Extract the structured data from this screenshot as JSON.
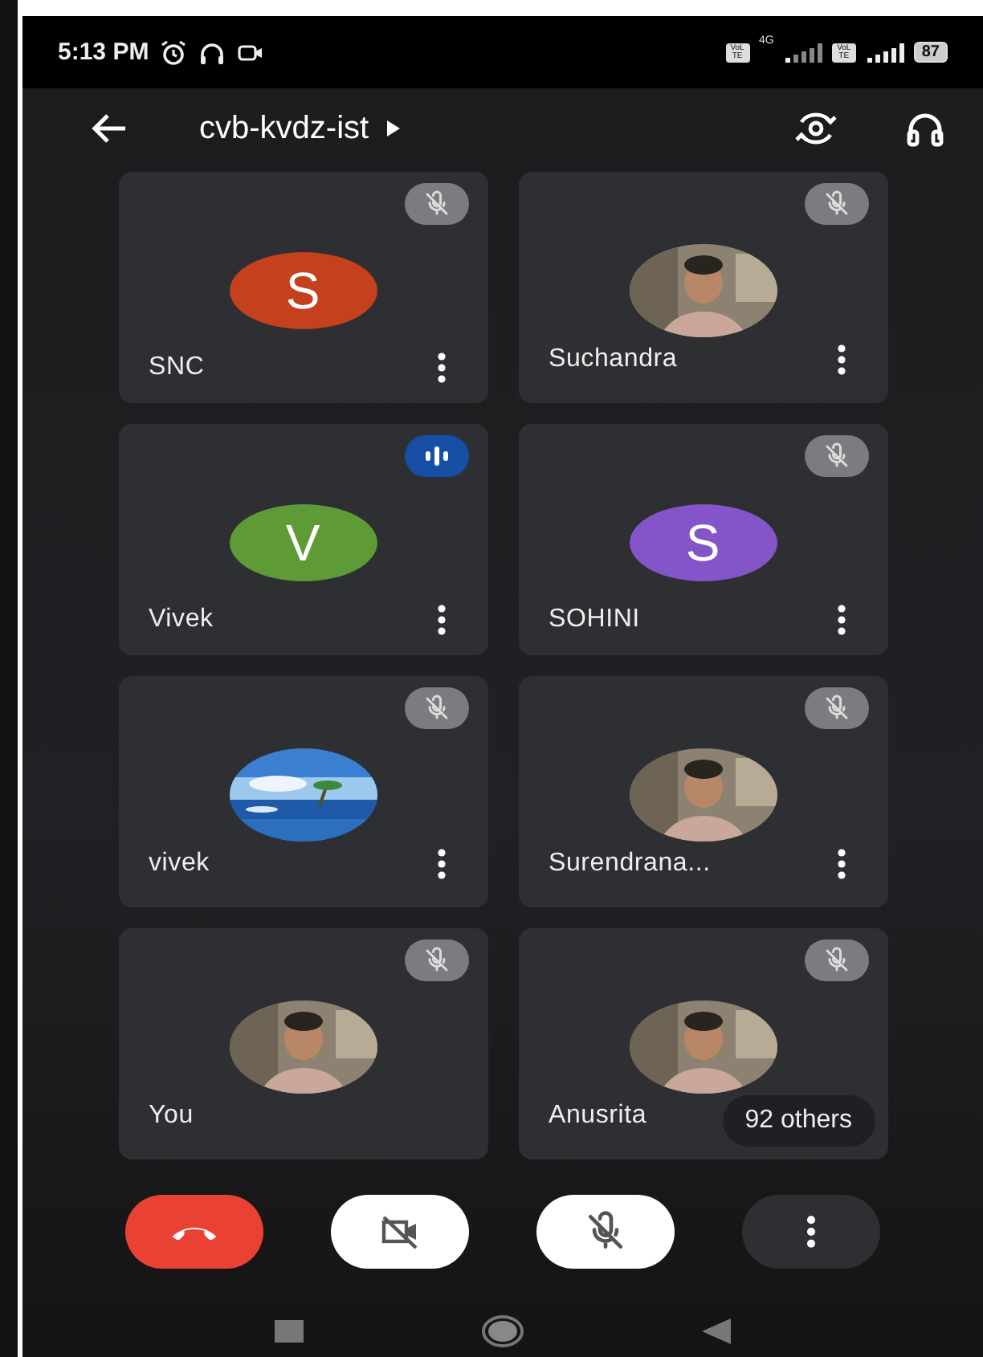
{
  "status_bar": {
    "time": "5:13 PM",
    "network": "4G",
    "sim_badges": [
      "VoLTE",
      "VoLTE"
    ],
    "battery": "87"
  },
  "top_bar": {
    "meeting_code": "cvb-kvdz-ist"
  },
  "tiles": [
    {
      "name": "SNC",
      "avatar": {
        "kind": "letter",
        "letter": "S",
        "color": "#c5401c"
      },
      "speaking": false,
      "more_button": true
    },
    {
      "name": "Suchandra",
      "avatar": {
        "kind": "portrait"
      },
      "speaking": false,
      "more_button": true
    },
    {
      "name": "Vivek",
      "avatar": {
        "kind": "letter",
        "letter": "V",
        "color": "#5e9a35"
      },
      "speaking": true,
      "more_button": true
    },
    {
      "name": "SOHINI",
      "avatar": {
        "kind": "letter",
        "letter": "S",
        "color": "#8455c9"
      },
      "speaking": false,
      "more_button": true
    },
    {
      "name": "vivek",
      "avatar": {
        "kind": "scenery"
      },
      "speaking": false,
      "more_button": true
    },
    {
      "name": "Surendrana...",
      "avatar": {
        "kind": "portrait"
      },
      "speaking": false,
      "more_button": true
    },
    {
      "name": "You",
      "avatar": {
        "kind": "portrait"
      },
      "speaking": false,
      "more_button": false
    },
    {
      "name": "Anusrita",
      "avatar": {
        "kind": "portrait"
      },
      "speaking": false,
      "more_button": false
    }
  ],
  "others_badge": "92 others"
}
